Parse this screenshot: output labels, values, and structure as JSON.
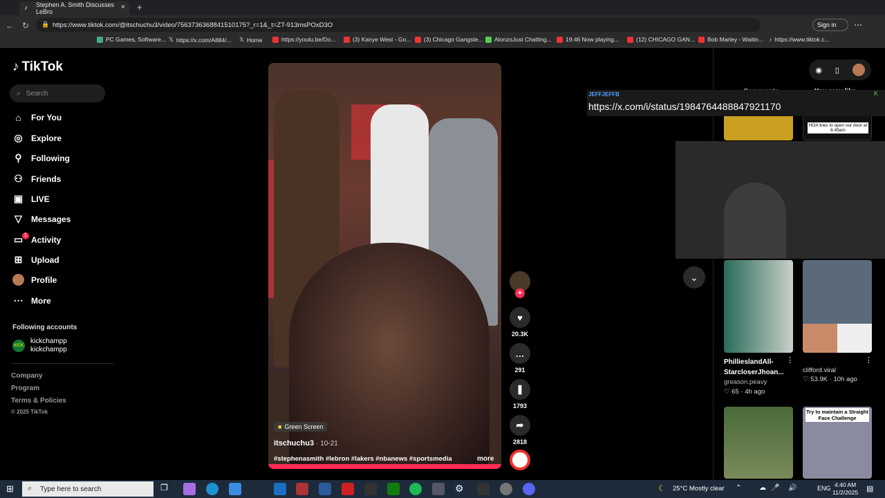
{
  "browser": {
    "tab_title": "Stephen A. Smith Discusses LeBro",
    "url": "https://www.tiktok.com/@itschuchu3/video/7563736368841510175?_r=1&_t=ZT-913msPOxD3O",
    "sign_in": "Sign in",
    "favorites": [
      "PC Games, Software...",
      "https://x.com/A884/...",
      "Home",
      "https://youtu.be/Do...",
      "(3) Kanye West - Go...",
      "(3) Chicago Gangste...",
      "AlonzoJust Chatting...",
      "19:46 Now playing...",
      "(12) CHICAGO GAN...",
      "Bob Marley - Waitin...",
      "https://www.tiktok.c..."
    ]
  },
  "sidebar": {
    "logo": "TikTok",
    "search_placeholder": "Search",
    "nav": [
      "For You",
      "Explore",
      "Following",
      "Friends",
      "LIVE",
      "Messages",
      "Activity",
      "Upload",
      "Profile",
      "More"
    ],
    "activity_badge": "1",
    "following_header": "Following accounts",
    "following_account": {
      "name": "kickchampp",
      "handle": "kickchampp"
    },
    "footer": [
      "Company",
      "Program",
      "Terms & Policies",
      "© 2025 TikTok"
    ]
  },
  "video": {
    "effect_tag": "Green Screen",
    "author": "itschuchu3",
    "date": "10-21",
    "hashtags": "#stephenasmith #lebron #lakers #nbanews #sportsmedia",
    "more": "more",
    "likes": "20.3K",
    "comments": "291",
    "saves": "1793",
    "shares": "2818"
  },
  "right_panel": {
    "tab_comments": "Comments",
    "tab_you_may_like": "You may like",
    "popup_user": "JEFFJEFFB",
    "popup_link": "https://x.com/i/status/1984764488847921170",
    "thumb_caption_1": "HOA tries to open our door at 6:45am",
    "card_left_title": "PhillieslandAll-StarcloserJhoan...",
    "card_left_user": "greason.peavy",
    "card_left_likes": "65",
    "card_left_age": "4h ago",
    "card_right_user": "clifford.viral",
    "card_right_likes": "53.9K",
    "card_right_age": "10h ago",
    "thumb_caption_2": "Try to maintain a Straight Face Challenge"
  },
  "taskbar": {
    "search_placeholder": "Type here to search",
    "weather": "25°C  Mostly clear",
    "lang": "ENG",
    "time": "4:40 AM",
    "date": "11/2/2025"
  },
  "colors": {
    "accent": "#fe2c55",
    "bg": "#000000",
    "link": "#4aa3ff"
  }
}
